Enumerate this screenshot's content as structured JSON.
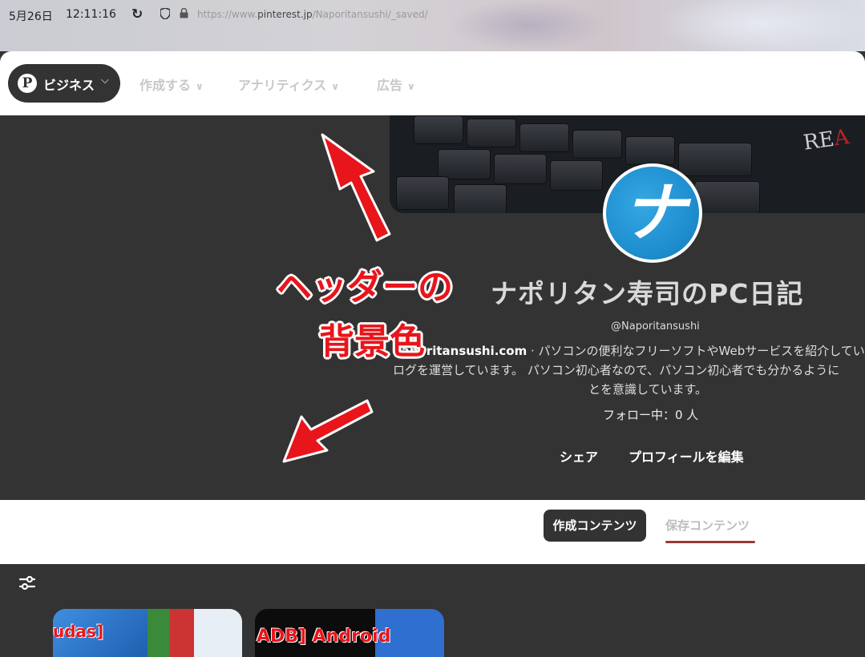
{
  "browser": {
    "date": "5月26日",
    "time": "12:11:16",
    "url_prefix": "https://www.",
    "url_domain": "pinterest.jp",
    "url_path": "/Naporitansushi/_saved/"
  },
  "nav": {
    "business_label": "ビジネス",
    "items": [
      {
        "label": "作成する"
      },
      {
        "label": "アナリティクス"
      },
      {
        "label": "広告"
      }
    ]
  },
  "profile": {
    "avatar_char": "ナ",
    "name": "ナポリタン寿司のPC日記",
    "handle": "@Naporitansushi",
    "bio_site": "naporitansushi.com",
    "bio_line1_rest": " · パソコンの便利なフリーソフトやWebサービスを紹介してい",
    "bio_line1_lead": "",
    "bio_line2": "ログを運営しています。 パソコン初心者なので、パソコン初心者でも分かるように",
    "bio_line3": "とを意識しています。",
    "following": "フォロー中：0 人",
    "share_label": "シェア",
    "edit_label": "プロフィールを編集",
    "cover_text_a": "RE",
    "cover_text_b": "A"
  },
  "annotation": {
    "line1": "ヘッダーの",
    "line2": "背景色",
    "color": "#e8151b"
  },
  "tabs": {
    "created": "作成コンテンツ",
    "saved": "保存コンテンツ"
  },
  "pins": [
    {
      "text": "udas]"
    },
    {
      "text": "ADB] Android"
    }
  ],
  "colors": {
    "header_bg": "#333333",
    "white": "#ffffff"
  }
}
